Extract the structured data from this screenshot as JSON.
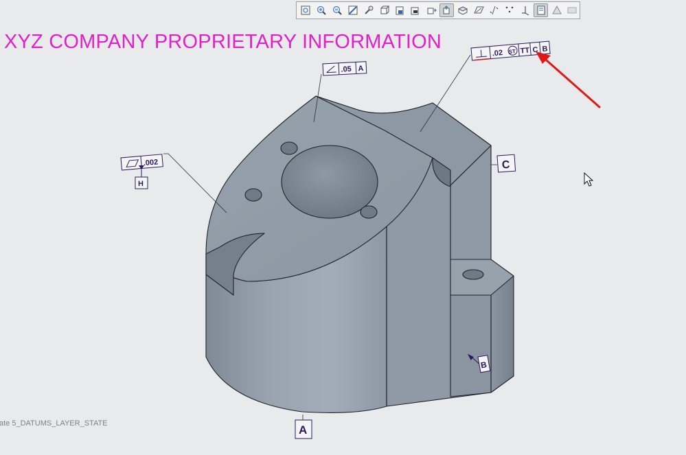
{
  "toolbar": {
    "buttons": [
      {
        "name": "refit-icon"
      },
      {
        "name": "zoom-in-icon"
      },
      {
        "name": "zoom-out-icon"
      },
      {
        "name": "repaint-icon"
      },
      {
        "name": "pan-zoom-icon"
      },
      {
        "name": "saved-views-icon"
      },
      {
        "name": "view-manager-icon"
      },
      {
        "name": "spin-center-icon"
      },
      {
        "name": "display-style-icon"
      },
      {
        "name": "annotation-display-icon"
      },
      {
        "name": "plane-display-icon"
      },
      {
        "name": "axis-display-icon"
      },
      {
        "name": "point-display-icon"
      },
      {
        "name": "csys-display-icon"
      },
      {
        "name": "annotation-orientation-icon"
      },
      {
        "name": "model-tree-icon"
      },
      {
        "name": "appearance-icon"
      }
    ]
  },
  "watermark": "XYZ COMPANY PROPRIETARY INFORMATION",
  "layer_state": "ate 5_DATUMS_LAYER_STATE",
  "annotations": {
    "angularity": {
      "value": ".05",
      "datum": "A"
    },
    "flatness": {
      "value": ".002",
      "datum_feature": "H"
    },
    "perpendicularity": {
      "value": ".02",
      "modifier": "ST",
      "extra": "TT",
      "datums": [
        "C",
        "B"
      ]
    },
    "datum_c": "C",
    "datum_b": "B",
    "datum_a": "A"
  },
  "colors": {
    "background": "#e8eaeb",
    "part": "#8f9aa6",
    "watermark": "#e020c8",
    "annotation": "#2a1a5e",
    "arrow": "#e01818"
  }
}
